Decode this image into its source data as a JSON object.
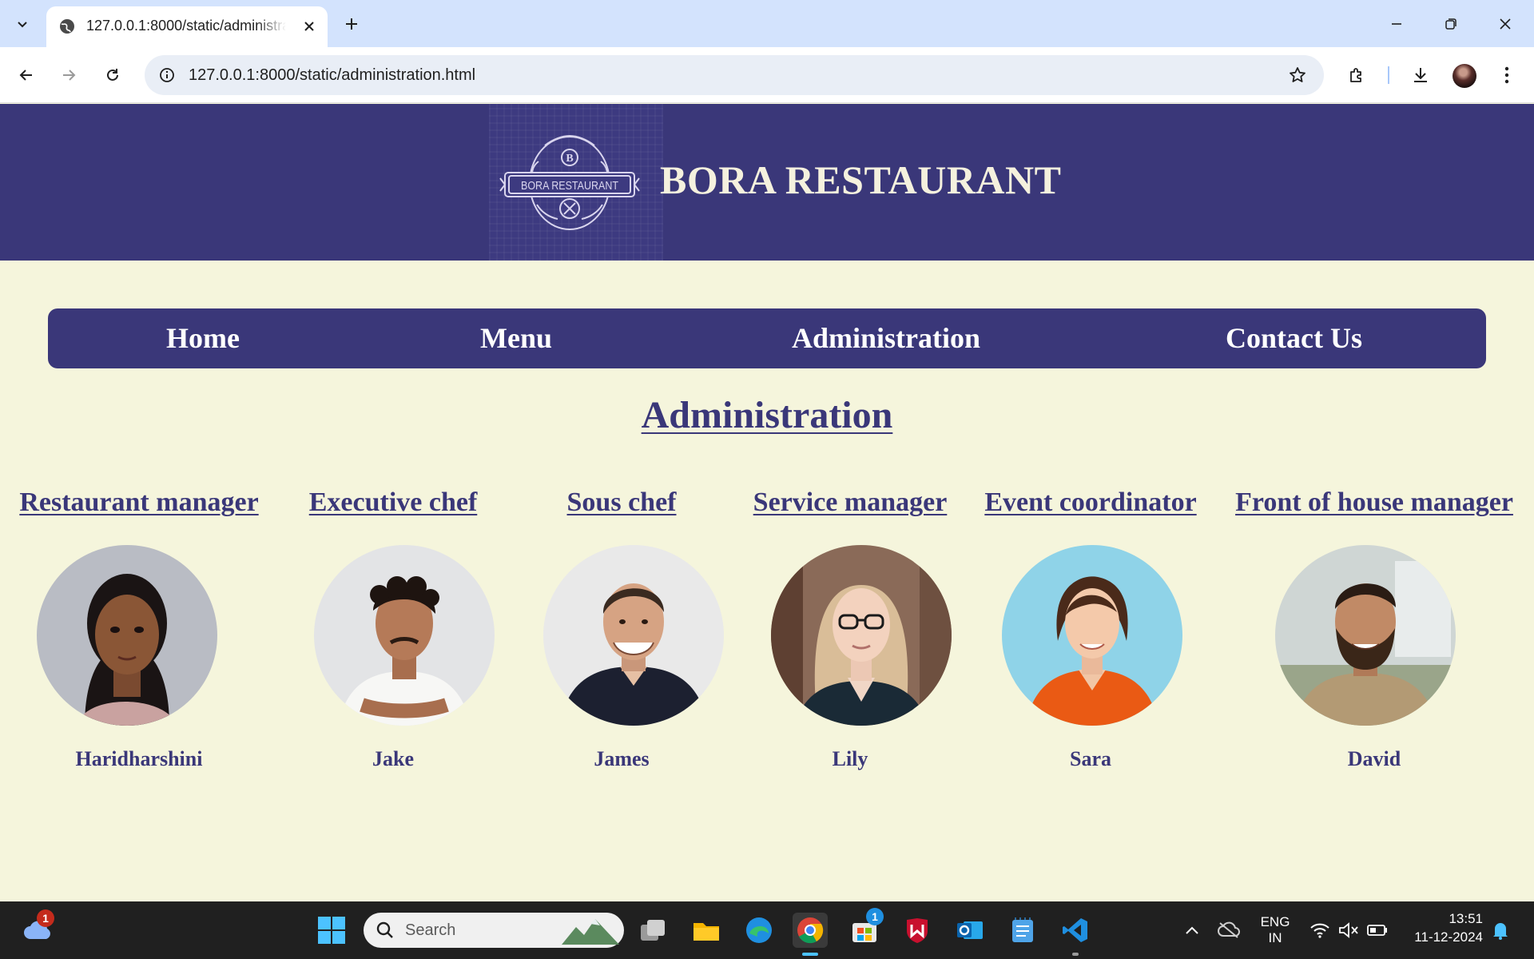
{
  "browser": {
    "tab_title": "127.0.0.1:8000/static/administration.html",
    "url": "127.0.0.1:8000/static/administration.html"
  },
  "site": {
    "logo_text": "BORA RESTAURANT",
    "logo_initial": "B",
    "title": "BORA RESTAURANT"
  },
  "nav": {
    "items": [
      {
        "label": "Home"
      },
      {
        "label": "Menu"
      },
      {
        "label": "Administration"
      },
      {
        "label": "Contact Us"
      }
    ]
  },
  "page": {
    "heading": "Administration"
  },
  "staff": [
    {
      "role": "Restaurant manager",
      "name": "Haridharshini"
    },
    {
      "role": "Executive chef",
      "name": "Jake"
    },
    {
      "role": "Sous chef",
      "name": "James"
    },
    {
      "role": "Service manager",
      "name": "Lily"
    },
    {
      "role": "Event coordinator",
      "name": "Sara"
    },
    {
      "role": "Front of house manager",
      "name": "David"
    }
  ],
  "taskbar": {
    "weather_badge": "1",
    "search_placeholder": "Search",
    "store_badge": "1",
    "lang_line1": "ENG",
    "lang_line2": "IN",
    "time": "13:51",
    "date": "11-12-2024"
  },
  "colors": {
    "brand": "#3a3779",
    "page_background": "#f5f5dc",
    "title_text": "#f5f1de"
  }
}
